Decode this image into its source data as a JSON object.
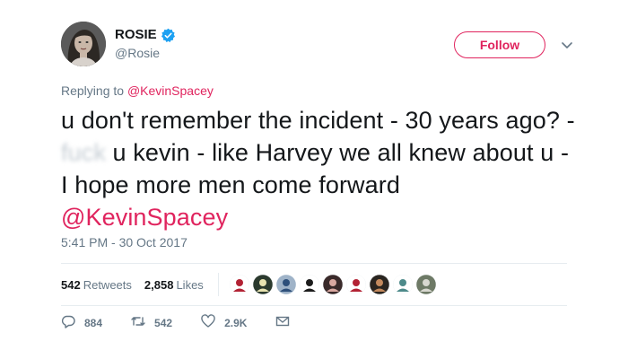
{
  "author": {
    "display_name": "ROSIE",
    "handle": "@Rosie",
    "verified": true
  },
  "follow_button": {
    "label": "Follow"
  },
  "reply": {
    "prefix": "Replying to ",
    "mention": "@KevinSpacey"
  },
  "tweet": {
    "text_part1": "u don't remember the incident - 30 years ago? - ",
    "censored_word": "fuck",
    "text_part2": " u kevin - like Harvey we all knew about u - I hope more men come forward",
    "mention": "@KevinSpacey"
  },
  "timestamp": "5:41 PM - 30 Oct 2017",
  "stats": {
    "retweets_count": "542",
    "retweets_label": "Retweets",
    "likes_count": "2,858",
    "likes_label": "Likes"
  },
  "liker_avatars": [
    {
      "name": "liker-avatar-flag-wings",
      "color": "#ffffff",
      "accent": "#b22234"
    },
    {
      "name": "liker-avatar-sign",
      "color": "#2b3a2e",
      "accent": "#e8e3b0"
    },
    {
      "name": "liker-avatar-group",
      "color": "#9fb3c8",
      "accent": "#2d4f7a"
    },
    {
      "name": "liker-avatar-bird",
      "color": "#ffffff",
      "accent": "#1c1c1c"
    },
    {
      "name": "liker-avatar-woman",
      "color": "#3a2a2a",
      "accent": "#d9a8a0"
    },
    {
      "name": "liker-avatar-gop",
      "color": "#ffffff",
      "accent": "#b22234"
    },
    {
      "name": "liker-avatar-man",
      "color": "#2a2520",
      "accent": "#c48a5e"
    },
    {
      "name": "liker-avatar-banner",
      "color": "#ffffff",
      "accent": "#4d8a8a"
    },
    {
      "name": "liker-avatar-outdoor",
      "color": "#6e7a66",
      "accent": "#d8d8d0"
    }
  ],
  "actions": {
    "replies": "884",
    "retweets": "542",
    "likes": "2.9K"
  },
  "colors": {
    "accent": "#e0245e",
    "secondary_text": "#657786",
    "verified_blue": "#1da1f2"
  }
}
